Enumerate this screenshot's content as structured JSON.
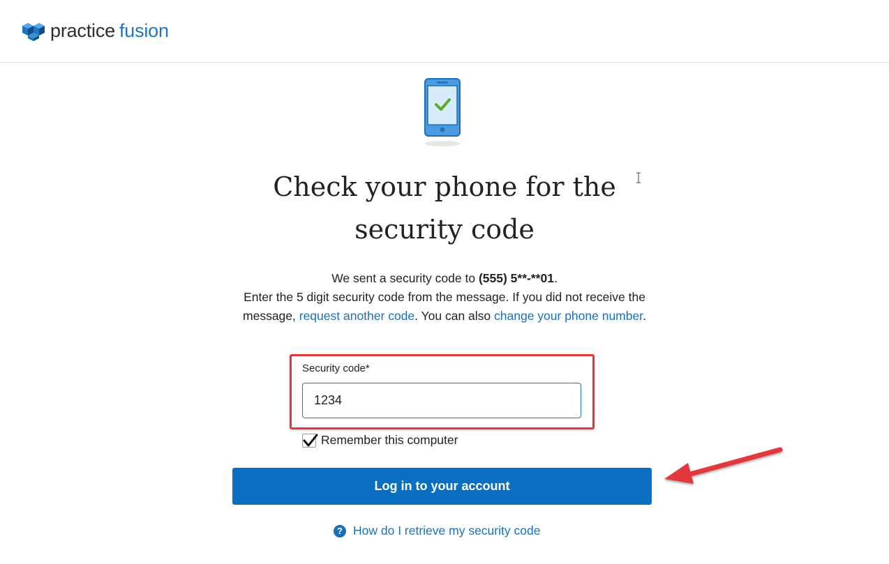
{
  "brand": {
    "name_part1": "practice",
    "name_part2": "fusion",
    "accent_color": "#1b77c4"
  },
  "page": {
    "title": "Check your phone for the security code",
    "message": {
      "line1_prefix": "We sent a security code to ",
      "phone_masked": "(555) 5**-**01",
      "line1_suffix": ".",
      "line2_prefix": "Enter the 5 digit security code from the message. If you did not receive the message, ",
      "request_link": "request another code",
      "line2_middle": ". You can also ",
      "change_phone_link": "change your phone number",
      "line2_suffix": "."
    }
  },
  "form": {
    "security_code_label": "Security code*",
    "security_code_value": "1234",
    "remember_label": "Remember this computer",
    "remember_checked": true,
    "submit_label": "Log in to your account"
  },
  "help": {
    "icon": "question-circle-icon",
    "link_text": "How do I retrieve my security code"
  },
  "icons": {
    "phone": "phone-check-icon",
    "logo": "practice-fusion-logo-icon"
  },
  "colors": {
    "button_bg": "#0b6fc1",
    "link": "#1b70b8",
    "highlight_border": "#e0393e",
    "check_green": "#5aad2b"
  }
}
